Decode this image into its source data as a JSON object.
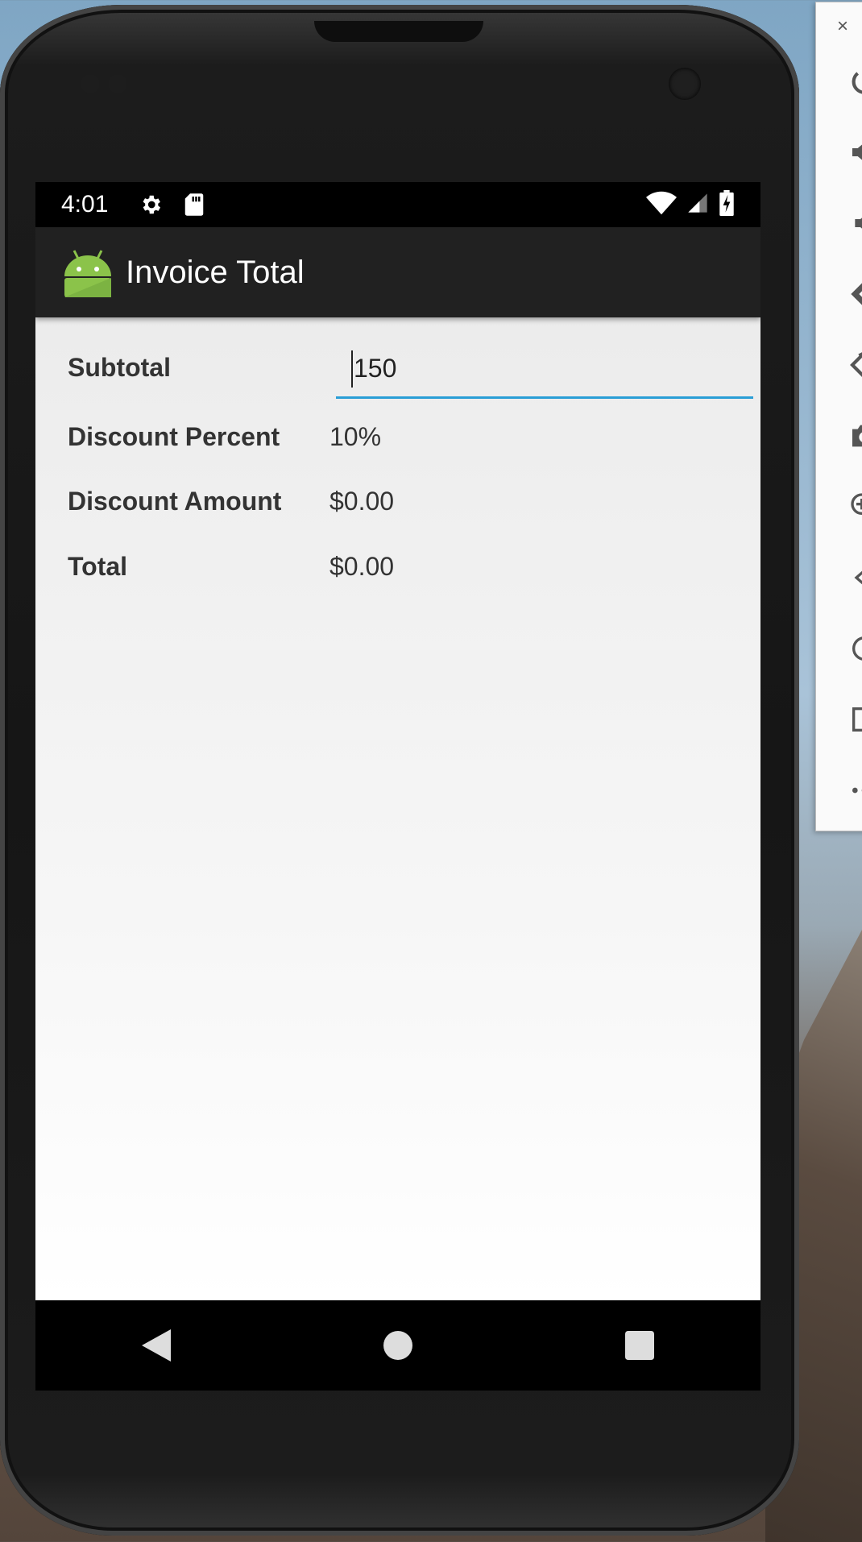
{
  "status_bar": {
    "time": "4:01"
  },
  "app_bar": {
    "title": "Invoice Total"
  },
  "form": {
    "subtotal_label": "Subtotal",
    "subtotal_value": "150",
    "discount_percent_label": "Discount Percent",
    "discount_percent_value": "10%",
    "discount_amount_label": "Discount Amount",
    "discount_amount_value": "$0.00",
    "total_label": "Total",
    "total_value": "$0.00"
  },
  "emulator_panel": {
    "close_label": "×"
  },
  "colors": {
    "accent": "#2a9ed6",
    "app_bar": "#212121",
    "android_green": "#8bc34a"
  },
  "icons": [
    "settings-icon",
    "sd-card-icon",
    "wifi-icon",
    "signal-icon",
    "battery-icon",
    "android-logo-icon",
    "back-icon",
    "home-icon",
    "recents-icon"
  ]
}
